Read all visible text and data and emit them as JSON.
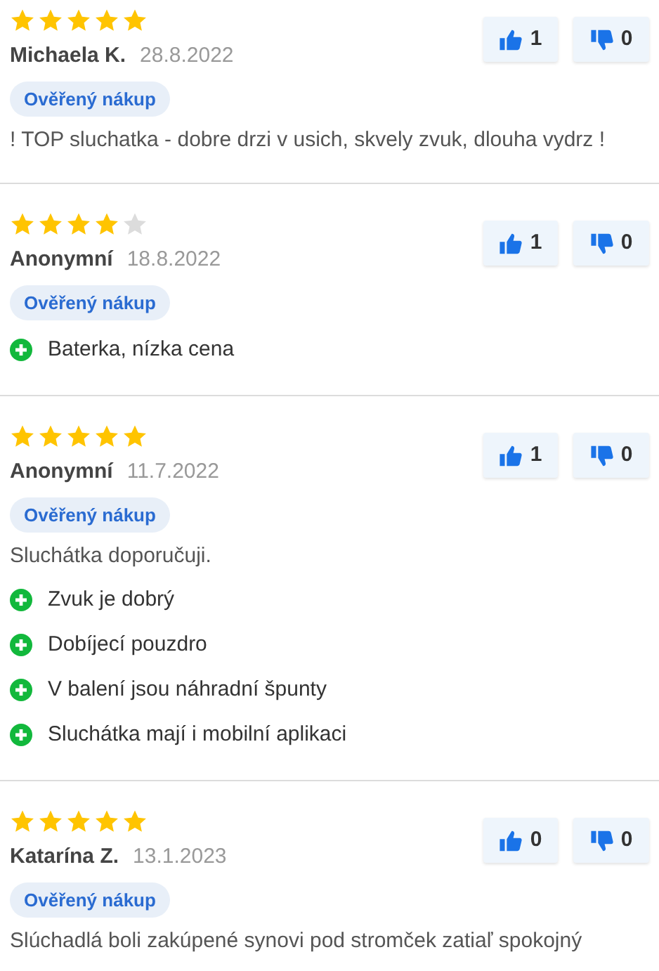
{
  "reviews": [
    {
      "stars": 5,
      "author": "Michaela K.",
      "date": "28.8.2022",
      "badge": "Ověřený nákup",
      "likes": "1",
      "dislikes": "0",
      "text": "! TOP sluchatka - dobre drzi v usich, skvely zvuk, dlouha vydrz !"
    },
    {
      "stars": 4,
      "author": "Anonymní",
      "date": "18.8.2022",
      "badge": "Ověřený nákup",
      "likes": "1",
      "dislikes": "0",
      "pros": [
        "Baterka, nízka cena"
      ]
    },
    {
      "stars": 5,
      "author": "Anonymní",
      "date": "11.7.2022",
      "badge": "Ověřený nákup",
      "likes": "1",
      "dislikes": "0",
      "text": "Sluchátka doporučuji.",
      "pros": [
        "Zvuk je dobrý",
        "Dobíjecí pouzdro",
        "V balení jsou náhradní špunty",
        "Sluchátka mají i mobilní aplikaci"
      ]
    },
    {
      "stars": 5,
      "author": "Katarína Z.",
      "date": "13.1.2023",
      "badge": "Ověřený nákup",
      "likes": "0",
      "dislikes": "0",
      "text": "Slúchadlá boli zakúpené synovi pod stromček zatiaľ spokojný"
    }
  ]
}
